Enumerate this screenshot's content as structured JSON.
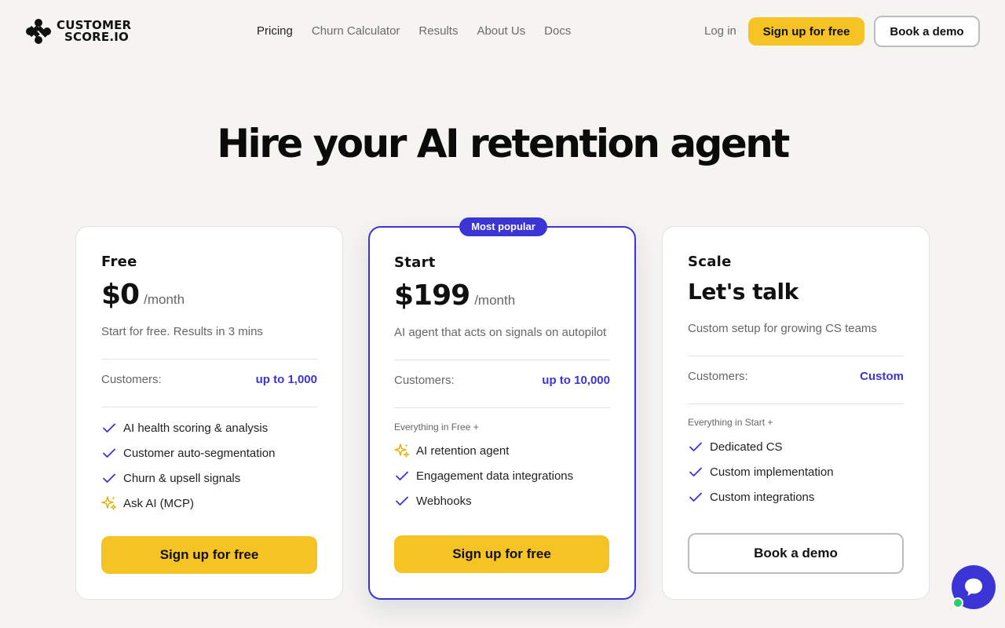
{
  "brand": {
    "line1": "CUSTOMER",
    "line2": "SCORE.IO"
  },
  "nav": {
    "items": [
      {
        "label": "Pricing"
      },
      {
        "label": "Churn Calculator"
      },
      {
        "label": "Results"
      },
      {
        "label": "About Us"
      },
      {
        "label": "Docs"
      }
    ],
    "login": "Log in",
    "signup": "Sign up for free",
    "demo": "Book a demo"
  },
  "hero": {
    "title": "Hire your AI retention agent"
  },
  "plans": {
    "free": {
      "name": "Free",
      "price": "$0",
      "per": "/month",
      "desc": "Start for free. Results in 3 mins",
      "customers_label": "Customers:",
      "customers_value": "up to 1,000",
      "features": [
        "AI health scoring & analysis",
        "Customer auto-segmentation",
        "Churn & upsell signals",
        "Ask AI (MCP)"
      ],
      "cta": "Sign up for free"
    },
    "start": {
      "badge": "Most popular",
      "name": "Start",
      "price": "$199",
      "per": "/month",
      "desc": "AI agent that acts on signals on autopilot",
      "customers_label": "Customers:",
      "customers_value": "up to 10,000",
      "everything": "Everything in Free +",
      "features": [
        "AI retention agent",
        "Engagement data integrations",
        "Webhooks"
      ],
      "cta": "Sign up for free"
    },
    "scale": {
      "name": "Scale",
      "price": "Let's talk",
      "desc": "Custom setup for growing CS teams",
      "customers_label": "Customers:",
      "customers_value": "Custom",
      "everything": "Everything in Start +",
      "features": [
        "Dedicated CS",
        "Custom implementation",
        "Custom integrations"
      ],
      "cta": "Book a demo"
    }
  },
  "colors": {
    "accent": "#3b35d6",
    "cta": "#f6c324",
    "background": "#f5f4f0"
  },
  "icons": {
    "check": "check-icon",
    "sparkle": "sparkle-icon",
    "chat": "chat-icon"
  }
}
